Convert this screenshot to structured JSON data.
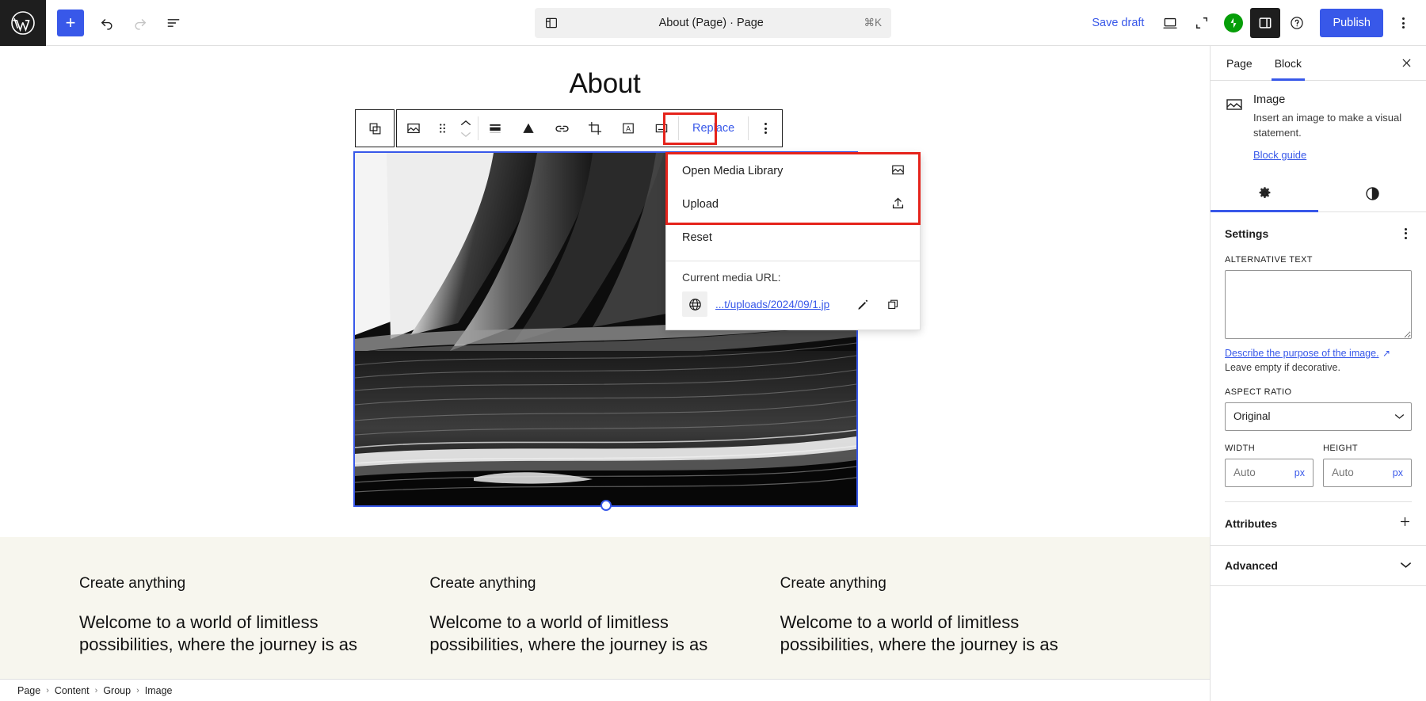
{
  "topbar": {
    "logo_icon": "wordpress-logo",
    "add_block_label": "+",
    "undo_icon": "undo-icon",
    "redo_icon": "redo-icon",
    "list_view_icon": "document-overview-icon",
    "document_icon": "document-icon",
    "document_title": "About (Page) · Page",
    "shortcut": "⌘K",
    "save_draft_label": "Save draft",
    "preview_icon": "desktop-preview-icon",
    "fullscreen_icon": "fullscreen-icon",
    "jetpack_icon": "jetpack-icon",
    "settings_panel_icon": "settings-sidebar-icon",
    "help_icon": "help-icon",
    "publish_label": "Publish",
    "options_icon": "more-options-icon"
  },
  "canvas": {
    "page_title": "About",
    "image_block": {
      "name": "image-block",
      "selected": true,
      "resize_handle": "bottom-center-resize-handle"
    },
    "columns": [
      {
        "heading": "Create anything",
        "paragraph": "Welcome to a world of limitless possibilities, where the journey is as"
      },
      {
        "heading": "Create anything",
        "paragraph": "Welcome to a world of limitless possibilities, where the journey is as"
      },
      {
        "heading": "Create anything",
        "paragraph": "Welcome to a world of limitless possibilities, where the journey is as"
      }
    ]
  },
  "block_toolbar": {
    "drag_icon": "drag-handle-icon",
    "block_type_icon": "image-block-icon",
    "grip_icon": "block-grip-icon",
    "move_up_icon": "chevron-up-icon",
    "move_down_icon": "chevron-down-icon",
    "align_icon": "align-icon",
    "filter_icon": "duotone-filter-icon",
    "link_icon": "link-icon",
    "crop_icon": "crop-icon",
    "caption_icon": "add-text-over-image-icon",
    "expand_icon": "caption-icon",
    "replace_label": "Replace",
    "more_options_icon": "more-options-icon"
  },
  "replace_dropdown": {
    "items": [
      {
        "label": "Open Media Library",
        "icon": "media-library-icon",
        "highlighted": true
      },
      {
        "label": "Upload",
        "icon": "upload-icon",
        "highlighted": true
      },
      {
        "label": "Reset",
        "icon": "",
        "highlighted": false
      }
    ],
    "url_label": "Current media URL:",
    "url_icon": "globe-icon",
    "url_value": "...t/uploads/2024/09/1.jp",
    "edit_icon": "pencil-icon",
    "copy_icon": "copy-icon"
  },
  "sidebar": {
    "tabs": [
      {
        "label": "Page",
        "active": false
      },
      {
        "label": "Block",
        "active": true
      }
    ],
    "close_icon": "close-icon",
    "block": {
      "icon": "image-block-icon",
      "name": "Image",
      "description": "Insert an image to make a visual statement.",
      "guide_link": "Block guide"
    },
    "icon_tabs": [
      {
        "icon": "settings-gear-icon",
        "active": true
      },
      {
        "icon": "styles-contrast-icon",
        "active": false
      }
    ],
    "settings": {
      "title": "Settings",
      "options_icon": "more-options-icon",
      "alt_text_label": "ALTERNATIVE TEXT",
      "alt_text_value": "",
      "alt_text_placeholder": "",
      "describe_link": "Describe the purpose of the image.",
      "external_icon": "external-link-icon",
      "decorative_help": "Leave empty if decorative.",
      "aspect_ratio_label": "ASPECT RATIO",
      "aspect_ratio_value": "Original",
      "aspect_ratio_chevron": "chevron-down-icon",
      "width_label": "WIDTH",
      "width_placeholder": "Auto",
      "width_unit": "px",
      "height_label": "HEIGHT",
      "height_placeholder": "Auto",
      "height_unit": "px"
    },
    "panels": [
      {
        "title": "Attributes",
        "icon": "plus-icon"
      },
      {
        "title": "Advanced",
        "icon": "chevron-down-icon"
      }
    ]
  },
  "breadcrumb": {
    "items": [
      "Page",
      "Content",
      "Group",
      "Image"
    ],
    "separator": "›"
  },
  "colors": {
    "accent": "#3858e9",
    "highlight": "#e5231b",
    "dark": "#1e1e1e",
    "band_bg": "#f7f6ee"
  }
}
